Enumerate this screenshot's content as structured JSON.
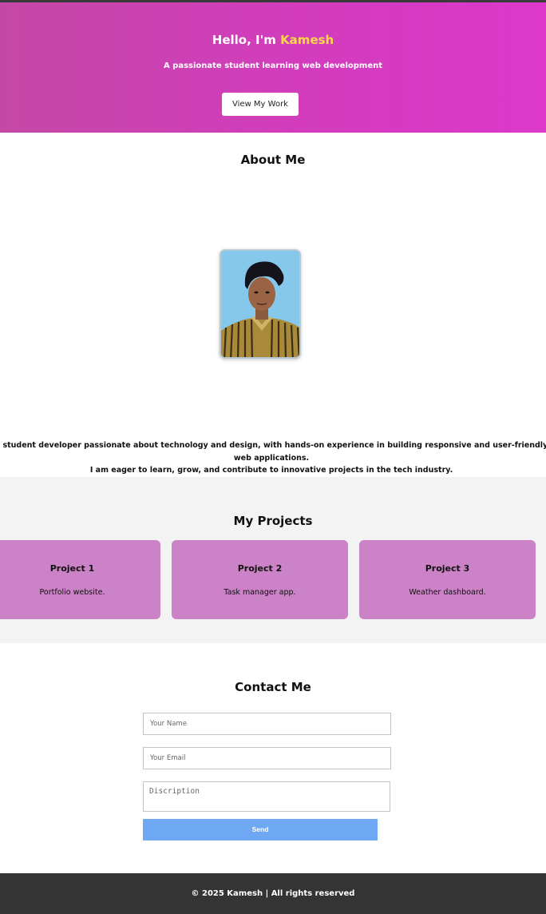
{
  "hero": {
    "greeting": "Hello, I'm",
    "name": "Kamesh",
    "subtitle": "A passionate student learning web development",
    "cta_label": "View My Work"
  },
  "about": {
    "title": "About Me",
    "photo_alt": "Kamesh",
    "line1": "a student developer passionate about technology and design, with hands-on experience in building responsive and user-friendly web applications.",
    "line2": "I am eager to learn, grow, and contribute to innovative projects in the tech industry."
  },
  "projects": {
    "title": "My Projects",
    "items": [
      {
        "title": "Project 1",
        "description": "Portfolio website."
      },
      {
        "title": "Project 2",
        "description": "Task manager app."
      },
      {
        "title": "Project 3",
        "description": "Weather dashboard."
      }
    ]
  },
  "contact": {
    "title": "Contact Me",
    "name_placeholder": "Your Name",
    "email_placeholder": "Your Email",
    "message_placeholder": "Discription",
    "send_label": "Send"
  },
  "footer": {
    "text": "© 2025 Kamesh | All rights reserved"
  },
  "colors": {
    "hero_gradient_start": "#c548a6",
    "hero_gradient_end": "#dd38cb",
    "name_highlight": "#ffd84a",
    "project_card": "#cc82c6",
    "send_button": "#6fa8f2",
    "footer_bg": "#343434"
  }
}
